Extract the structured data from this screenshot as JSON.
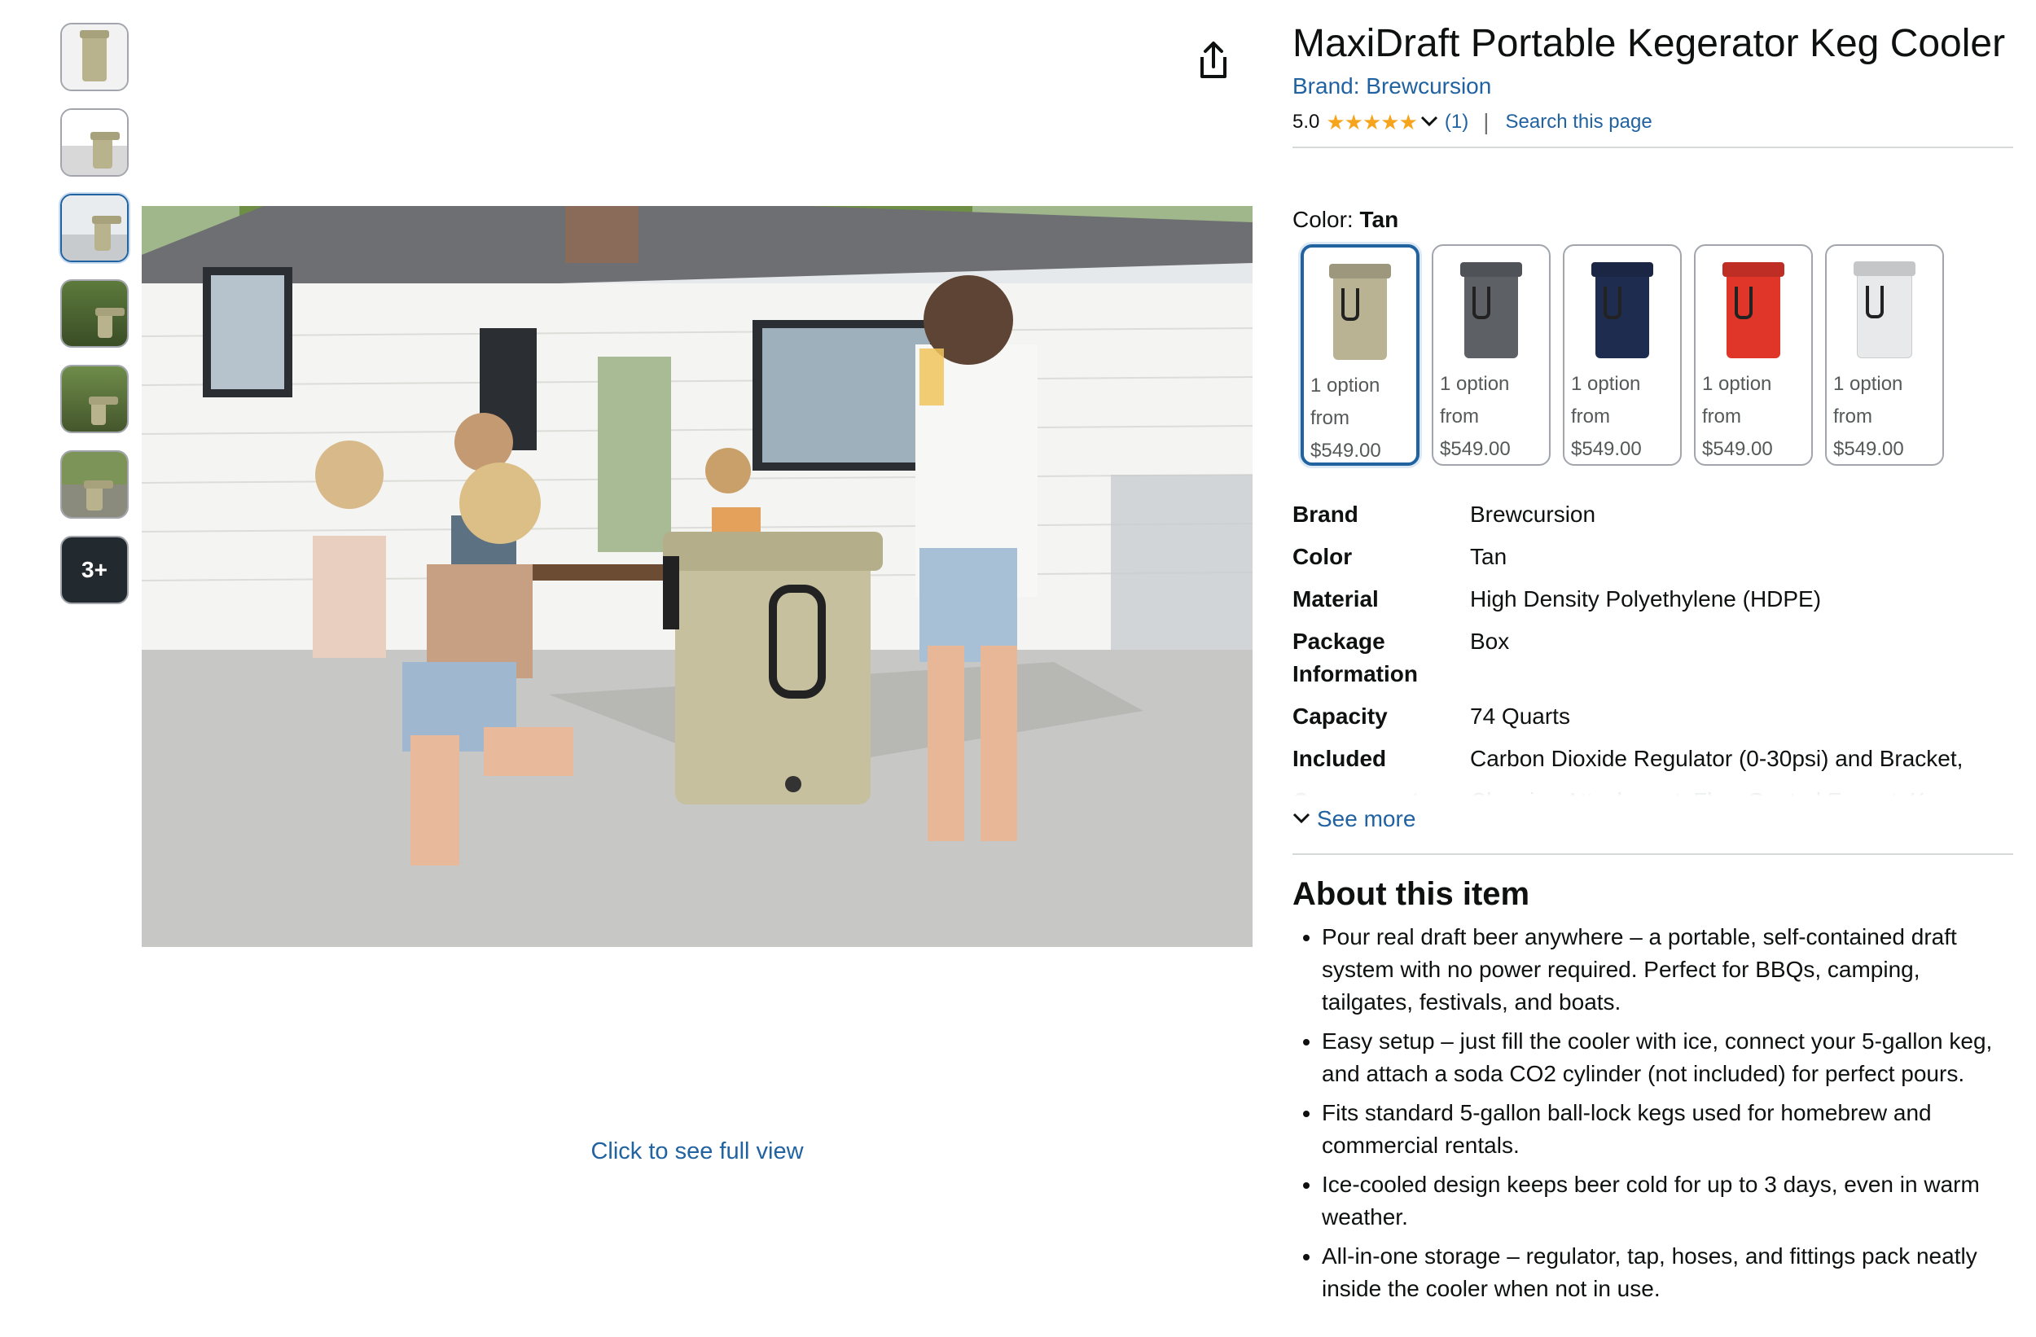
{
  "thumbnails": {
    "more_label": "3+"
  },
  "main_image": {
    "alt": "Two women outdoors using the tan kegerator cooler on a patio",
    "full_view_label": "Click to see full view"
  },
  "product": {
    "title": "MaxiDraft Portable Kegerator Keg Cooler",
    "brand_link": "Brand: Brewcursion",
    "rating_value": "5.0",
    "stars": "★★★★★",
    "review_count": "(1)",
    "separator": "|",
    "search_page": "Search this page"
  },
  "color": {
    "label": "Color:",
    "selected": "Tan",
    "options": [
      {
        "name": "Tan",
        "hex": "#b9b393",
        "line1": "1 option",
        "line2": "from",
        "price": "$549.00"
      },
      {
        "name": "Gray",
        "hex": "#5d6166",
        "line1": "1 option",
        "line2": "from",
        "price": "$549.00"
      },
      {
        "name": "Navy",
        "hex": "#1e2d4f",
        "line1": "1 option",
        "line2": "from",
        "price": "$549.00"
      },
      {
        "name": "Red",
        "hex": "#e0362a",
        "line1": "1 option",
        "line2": "from",
        "price": "$549.00"
      },
      {
        "name": "White",
        "hex": "#e8e9ea",
        "line1": "1 option",
        "line2": "from",
        "price": "$549.00"
      }
    ]
  },
  "specs": [
    {
      "key": "Brand",
      "value": "Brewcursion"
    },
    {
      "key": "Color",
      "value": "Tan"
    },
    {
      "key": "Material",
      "value": "High Density Polyethylene (HDPE)"
    },
    {
      "key": "Package Information",
      "value": "Box"
    },
    {
      "key": "Capacity",
      "value": "74 Quarts"
    },
    {
      "key": "Included",
      "value": "Carbon Dioxide Regulator (0-30psi) and Bracket,"
    }
  ],
  "spec_cutoff": {
    "key": "Components",
    "value": "Cleaning Attachment, Flow Control Faucet, Keg"
  },
  "see_more": "See more",
  "about": {
    "title": "About this item",
    "bullets": [
      "Pour real draft beer anywhere – a portable, self-contained draft system with no power required. Perfect for BBQs, camping, tailgates, festivals, and boats.",
      "Easy setup – just fill the cooler with ice, connect your 5-gallon keg, and attach a soda CO2 cylinder (not included) for perfect pours.",
      "Fits standard 5-gallon ball-lock kegs used for homebrew and commercial rentals.",
      "Ice-cooled design keeps beer cold for up to 3 days, even in warm weather.",
      "All-in-one storage – regulator, tap, hoses, and fittings pack neatly inside the cooler when not in use."
    ]
  }
}
